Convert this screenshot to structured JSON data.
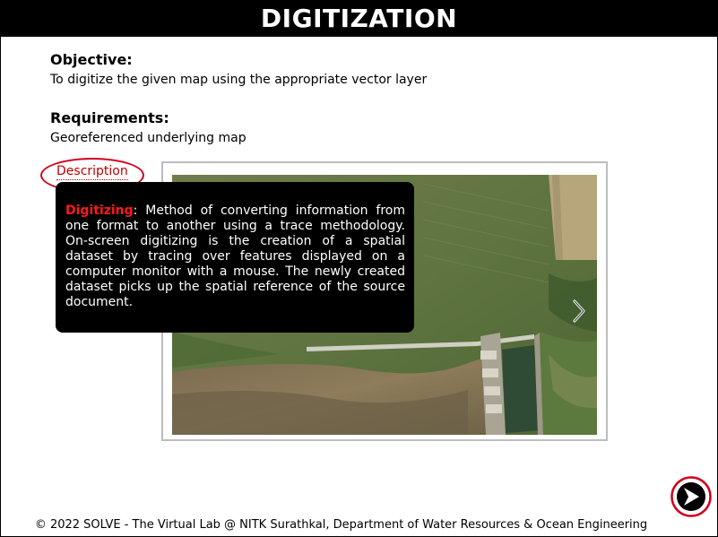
{
  "header": {
    "title": "DIGITIZATION"
  },
  "objective": {
    "heading": "Objective:",
    "text": "To digitize the given map using the appropriate vector layer"
  },
  "requirements": {
    "heading": "Requirements:",
    "text": "Georeferenced underlying map"
  },
  "description_link": {
    "label": "Description",
    "highlight_color": "#d0021b"
  },
  "tooltip": {
    "term": "Digitizing",
    "text": ": Method of converting information from one format to another using a trace methodology. On-screen digitizing is the creation of a spatial dataset by tracing over features displayed on a computer monitor with a mouse. The newly created dataset picks up the spatial reference of the source document."
  },
  "image_viewer": {
    "next_icon": "chevron-right-icon"
  },
  "footer": {
    "text": "© 2022 SOLVE - The Virtual Lab @ NITK Surathkal, Department of Water Resources & Ocean Engineering"
  },
  "navigation": {
    "next_icon": "arrow-right-circle-icon"
  },
  "colors": {
    "header_bg": "#000000",
    "link": "#c00000",
    "tooltip_term": "#ff1a1a"
  }
}
